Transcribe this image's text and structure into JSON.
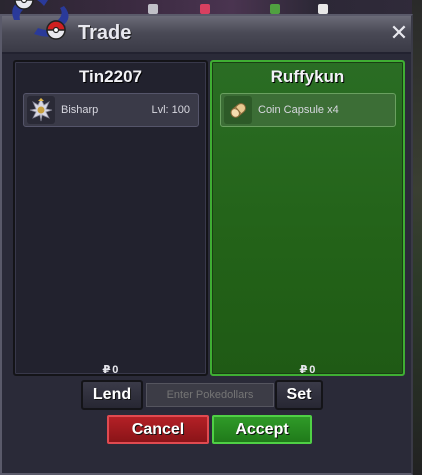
{
  "window": {
    "title": "Trade",
    "close_label": "✕"
  },
  "left_panel": {
    "player_name": "Tin2207",
    "items": [
      {
        "name": "Bisharp",
        "level": "Lvl: 100",
        "icon": "bisharp-icon"
      }
    ],
    "currency_symbol": "₽",
    "money": "0"
  },
  "right_panel": {
    "player_name": "Ruffykun",
    "items": [
      {
        "name": "Coin Capsule x4",
        "icon": "coin-capsule-icon"
      }
    ],
    "currency_symbol": "₽",
    "money": "0"
  },
  "controls": {
    "lend_label": "Lend",
    "pokedollar_placeholder": "Enter Pokedollars",
    "set_label": "Set",
    "cancel_label": "Cancel",
    "accept_label": "Accept"
  },
  "colors": {
    "accent_green": "#2f9a28",
    "cancel_red": "#b32026",
    "window_bg": "#2a2a38"
  }
}
